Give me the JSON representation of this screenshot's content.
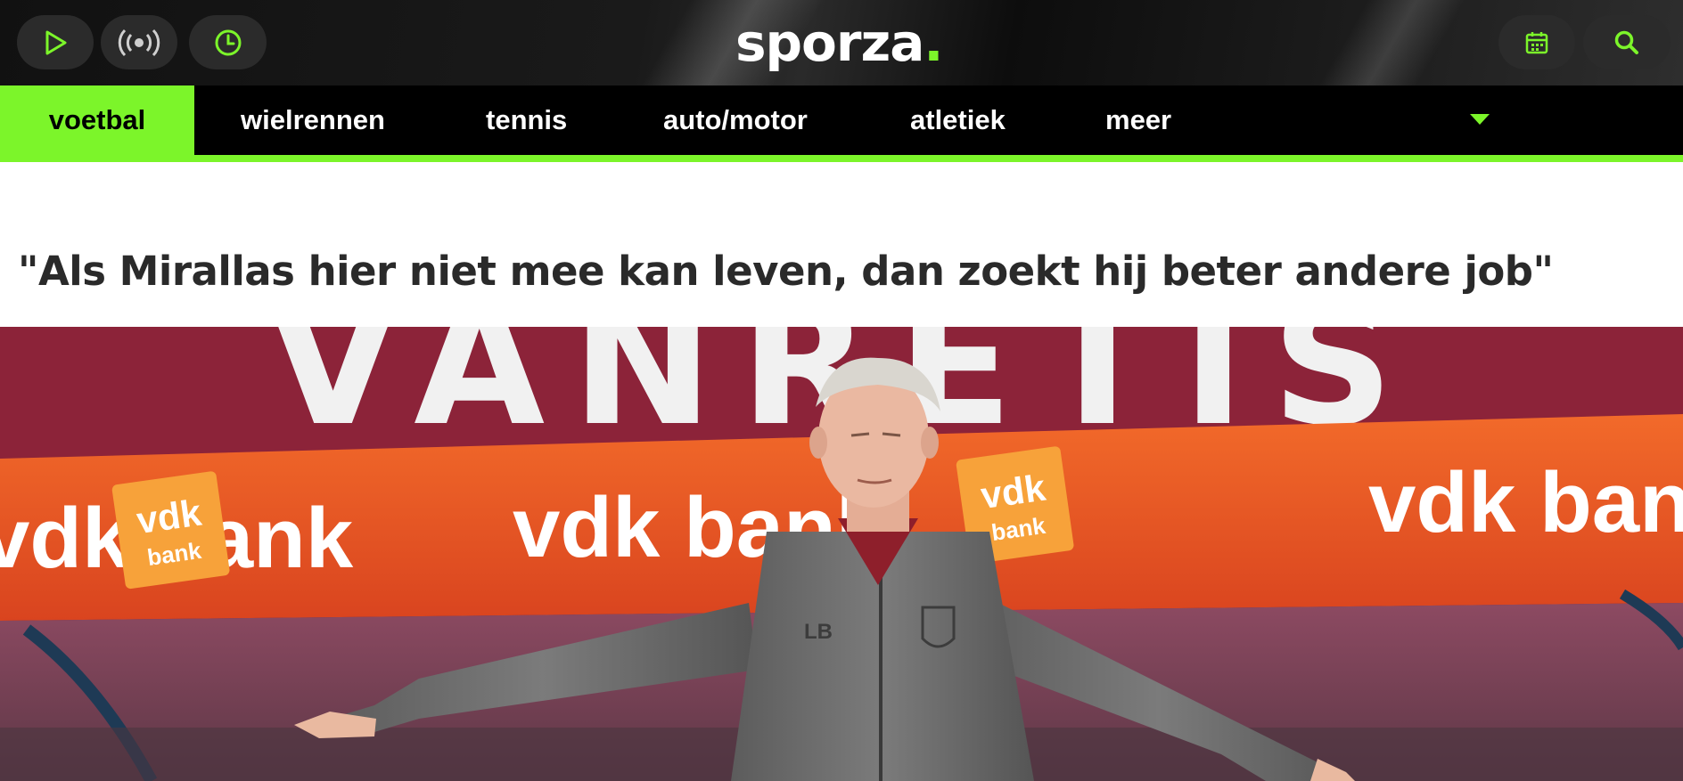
{
  "header": {
    "logo_text": "sporza",
    "logo_dot": ".",
    "left_buttons": [
      {
        "icon": "play-icon"
      },
      {
        "icon": "live-radio-icon"
      },
      {
        "icon": "clock-icon"
      }
    ],
    "right_buttons": [
      {
        "icon": "calendar-icon"
      },
      {
        "icon": "search-icon"
      }
    ],
    "accent_color": "#7cf52a"
  },
  "nav": {
    "items": [
      {
        "label": "voetbal",
        "active": true
      },
      {
        "label": "wielrennen"
      },
      {
        "label": "tennis"
      },
      {
        "label": "auto/motor"
      },
      {
        "label": "atletiek"
      },
      {
        "label": "meer"
      }
    ],
    "toggle_icon": "chevron-down-icon"
  },
  "article": {
    "headline": "\"Als Mirallas hier niet mee kan leven, dan zoekt hij beter andere job\""
  },
  "hero": {
    "banner_text_top": "VANRETIS",
    "sponsor_text": "vdk bank",
    "sponsor_logo_line1": "vdk",
    "sponsor_logo_line2": "bank",
    "jacket_initials": "LB"
  }
}
